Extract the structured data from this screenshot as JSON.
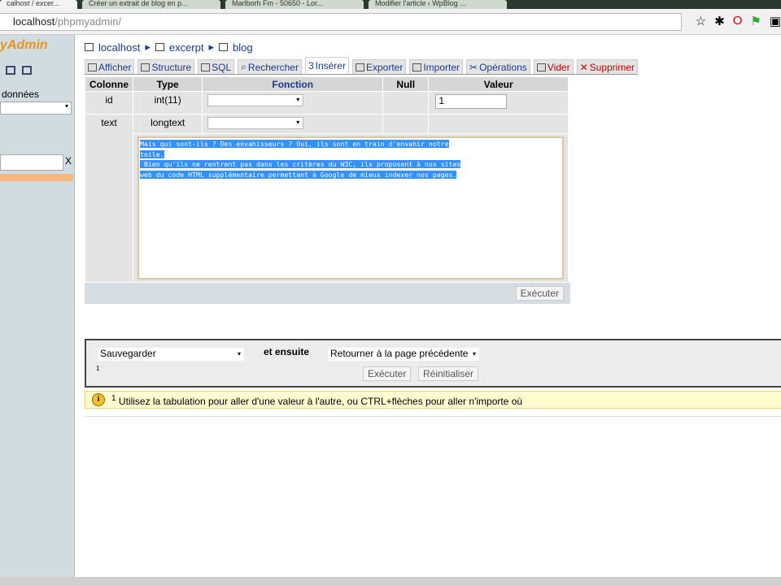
{
  "browser": {
    "tabs": [
      "calhost / excer...",
      "Créer un extrait de blog en p...",
      "Marlborh Fm - 50650 - Lor...",
      "Modifier l'article ‹ WpBlog ..."
    ],
    "url_host": "localhost",
    "url_path": "/phpmyadmin/"
  },
  "sidebar": {
    "logo": "yAdmin",
    "db_label": "données",
    "filter_clear": "X"
  },
  "breadcrumb": [
    "localhost",
    "excerpt",
    "blog"
  ],
  "tabs": [
    {
      "label": "Afficher"
    },
    {
      "label": "Structure"
    },
    {
      "label": "SQL"
    },
    {
      "label": "Rechercher"
    },
    {
      "label": "Insérer",
      "active": true
    },
    {
      "label": "Exporter"
    },
    {
      "label": "Importer"
    },
    {
      "label": "Opérations"
    },
    {
      "label": "Vider",
      "danger": true
    },
    {
      "label": "Supprimer",
      "danger": true
    }
  ],
  "table": {
    "headers": [
      "Colonne",
      "Type",
      "Fonction",
      "Null",
      "Valeur"
    ],
    "rows": [
      {
        "column": "id",
        "type": "int(11)",
        "value": "1"
      },
      {
        "column": "text",
        "type": "longtext"
      }
    ],
    "textarea": "Mais qui sont-ils ? Des envahisseurs ? Oui, ils sont en train d'envahir notre\ntoile.\n Bien qu'ils ne rentrent pas dans les critères du W3C, ils proposent à nos sites\nweb du code HTML supplémentaire permettant à Google de mieux indexer nos pages."
  },
  "execute_label": "Exécuter",
  "after": {
    "action": "Sauvegarder",
    "then_label": "et ensuite",
    "then_value": "Retourner à la page précédente",
    "footnote": "1",
    "execute": "Exécuter",
    "reset": "Réinitialiser"
  },
  "notice": {
    "sup": "1",
    "text": "Utilisez la tabulation pour aller d'une valeur à l'autre, ou CTRL+flèches pour aller n'importe où"
  }
}
